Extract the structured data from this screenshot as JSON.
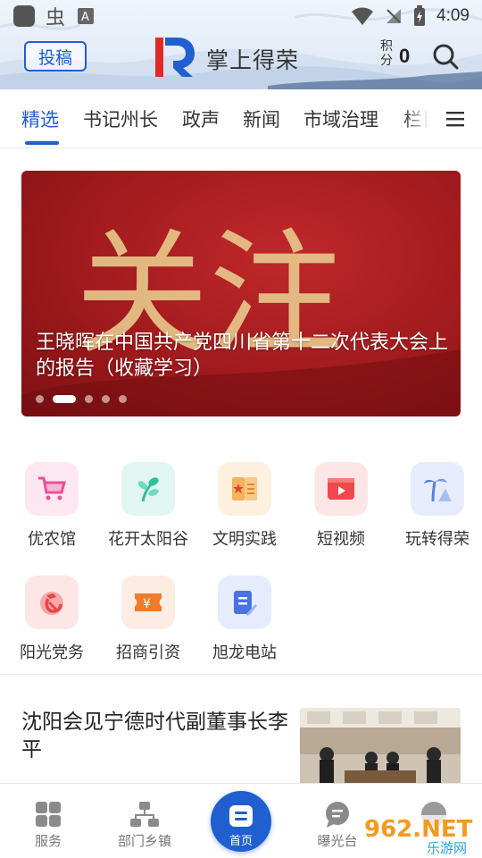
{
  "status_bar": {
    "time": "4:09",
    "left_icons": [
      "app-icon",
      "bug-icon",
      "a-icon"
    ],
    "right_icons": [
      "wifi-icon",
      "no-signal-icon",
      "battery-icon"
    ]
  },
  "app_bar": {
    "submit_label": "投稿",
    "logo_letter": "R",
    "title": "掌上得荣",
    "points_label": "积分",
    "points_value": "0"
  },
  "tabs": [
    "精选",
    "书记州长",
    "政声",
    "新闻",
    "市域治理",
    "栏目"
  ],
  "active_tab": 0,
  "banner": {
    "caption": "王晓晖在中国共产党四川省第十二次代表大会上的报告（收藏学习）",
    "background_text": "关注",
    "slide_count": 5,
    "active_slide": 1
  },
  "services": [
    {
      "label": "优农馆",
      "icon": "shopping-cart-icon",
      "bg": "#fde8f1",
      "color": "#ec4f9a"
    },
    {
      "label": "花开太阳谷",
      "icon": "leaf-icon",
      "bg": "#e2f6f1",
      "color": "#2fbf9b"
    },
    {
      "label": "文明实践",
      "icon": "book-star-icon",
      "bg": "#fdf0df",
      "color": "#f0a13a"
    },
    {
      "label": "短视频",
      "icon": "video-icon",
      "bg": "#fde6e6",
      "color": "#f0484b"
    },
    {
      "label": "玩转得荣",
      "icon": "palm-tree-icon",
      "bg": "#e6ecfb",
      "color": "#5a7de3"
    },
    {
      "label": "阳光党务",
      "icon": "party-emblem-icon",
      "bg": "#fde6e6",
      "color": "#e84545"
    },
    {
      "label": "招商引资",
      "icon": "ticket-yen-icon",
      "bg": "#fdece1",
      "color": "#f27a2b"
    },
    {
      "label": "旭龙电站",
      "icon": "document-edit-icon",
      "bg": "#e6ecfb",
      "color": "#4a72e0"
    }
  ],
  "article": {
    "title": "沈阳会见宁德时代副董事长李平"
  },
  "bottom_nav": [
    {
      "label": "服务",
      "icon": "grid-icon"
    },
    {
      "label": "部门乡镇",
      "icon": "org-chart-icon"
    },
    {
      "label": "首页",
      "icon": "home-document-icon"
    },
    {
      "label": "曝光台",
      "icon": "chat-bubble-icon"
    },
    {
      "label": "",
      "icon": "profile-icon"
    }
  ],
  "watermark": {
    "text": "962.NET",
    "subtext": "乐游网"
  },
  "colors": {
    "accent": "#1f5fcf",
    "banner_red": "#a01a1d"
  }
}
